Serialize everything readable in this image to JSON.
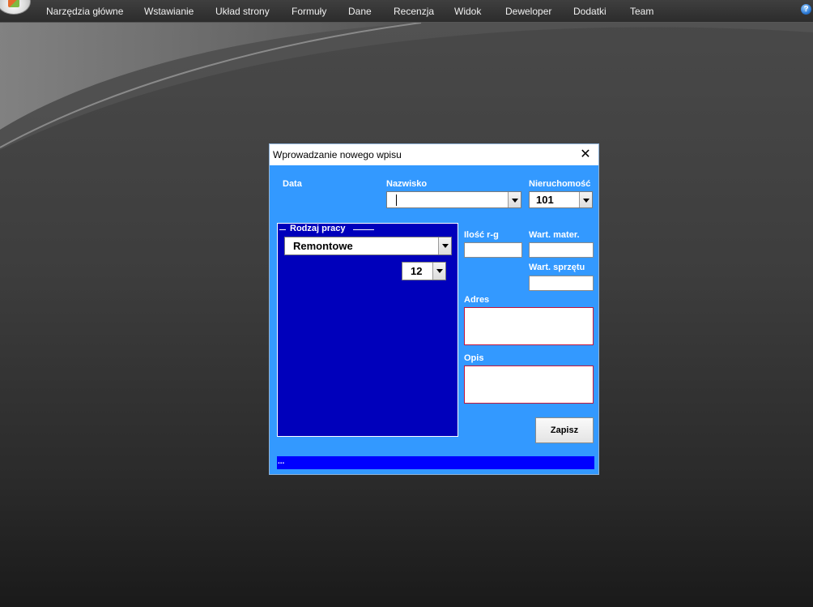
{
  "ribbon": {
    "tabs": [
      "Narzędzia główne",
      "Wstawianie",
      "Układ strony",
      "Formuły",
      "Dane",
      "Recenzja",
      "Widok",
      "Deweloper",
      "Dodatki",
      "Team"
    ],
    "help_glyph": "?"
  },
  "icons": {
    "office": "office-logo-icon",
    "help": "help-icon",
    "close": "close-icon",
    "dropdown": "chevron-down-icon"
  },
  "dialog": {
    "title": "Wprowadzanie nowego wpisu",
    "close_glyph": "✕",
    "labels": {
      "data": "Data",
      "nazwisko": "Nazwisko",
      "nieruchomosc": "Nieruchomość",
      "rodzaj_pracy": "Rodzaj pracy",
      "ilosc_rg": "Ilość r-g",
      "wart_mater": "Wart. mater.",
      "wart_sprzetu": "Wart. sprzętu",
      "adres": "Adres",
      "opis": "Opis"
    },
    "fields": {
      "nazwisko": "",
      "nieruchomosc": "101",
      "rodzaj_pracy": "Remontowe",
      "hours": "12",
      "ilosc_rg": "",
      "wart_mater": "",
      "wart_sprzetu": "",
      "adres": "",
      "opis": ""
    },
    "save_label": "Zapisz",
    "status_text": "..."
  },
  "colors": {
    "dialog_bg": "#3399ff",
    "frame_bg": "#0000bb",
    "status_bg": "#0000ff",
    "textarea_border": "#c4163a"
  }
}
